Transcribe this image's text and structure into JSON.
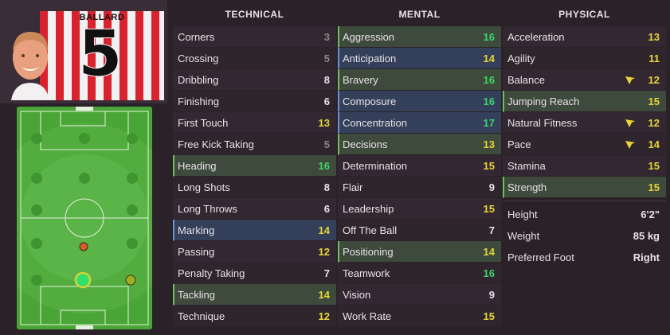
{
  "player": {
    "shirt_name": "BALLARD",
    "shirt_number": "5"
  },
  "columns": {
    "technical": "TECHNICAL",
    "mental": "MENTAL",
    "physical": "PHYSICAL"
  },
  "colors": {
    "low": "#8d8489",
    "mid": "#e8e2e6",
    "good": "#e7d53a",
    "great": "#3fd46b",
    "highlight_green": "#6fbf5a",
    "highlight_blue": "#6a8fd6"
  },
  "technical": [
    {
      "label": "Corners",
      "value": "3"
    },
    {
      "label": "Crossing",
      "value": "5"
    },
    {
      "label": "Dribbling",
      "value": "8"
    },
    {
      "label": "Finishing",
      "value": "6"
    },
    {
      "label": "First Touch",
      "value": "13"
    },
    {
      "label": "Free Kick Taking",
      "value": "5"
    },
    {
      "label": "Heading",
      "value": "16"
    },
    {
      "label": "Long Shots",
      "value": "8"
    },
    {
      "label": "Long Throws",
      "value": "6"
    },
    {
      "label": "Marking",
      "value": "14"
    },
    {
      "label": "Passing",
      "value": "12"
    },
    {
      "label": "Penalty Taking",
      "value": "7"
    },
    {
      "label": "Tackling",
      "value": "14"
    },
    {
      "label": "Technique",
      "value": "12"
    }
  ],
  "mental": [
    {
      "label": "Aggression",
      "value": "16"
    },
    {
      "label": "Anticipation",
      "value": "14"
    },
    {
      "label": "Bravery",
      "value": "16"
    },
    {
      "label": "Composure",
      "value": "16"
    },
    {
      "label": "Concentration",
      "value": "17"
    },
    {
      "label": "Decisions",
      "value": "13"
    },
    {
      "label": "Determination",
      "value": "15"
    },
    {
      "label": "Flair",
      "value": "9"
    },
    {
      "label": "Leadership",
      "value": "15"
    },
    {
      "label": "Off The Ball",
      "value": "7"
    },
    {
      "label": "Positioning",
      "value": "14"
    },
    {
      "label": "Teamwork",
      "value": "16"
    },
    {
      "label": "Vision",
      "value": "9"
    },
    {
      "label": "Work Rate",
      "value": "15"
    }
  ],
  "physical": [
    {
      "label": "Acceleration",
      "value": "13"
    },
    {
      "label": "Agility",
      "value": "11"
    },
    {
      "label": "Balance",
      "value": "12"
    },
    {
      "label": "Jumping Reach",
      "value": "15"
    },
    {
      "label": "Natural Fitness",
      "value": "12"
    },
    {
      "label": "Pace",
      "value": "14"
    },
    {
      "label": "Stamina",
      "value": "15"
    },
    {
      "label": "Strength",
      "value": "15"
    }
  ],
  "info": [
    {
      "label": "Height",
      "value": "6'2\""
    },
    {
      "label": "Weight",
      "value": "85 kg"
    },
    {
      "label": "Preferred Foot",
      "value": "Right"
    }
  ]
}
